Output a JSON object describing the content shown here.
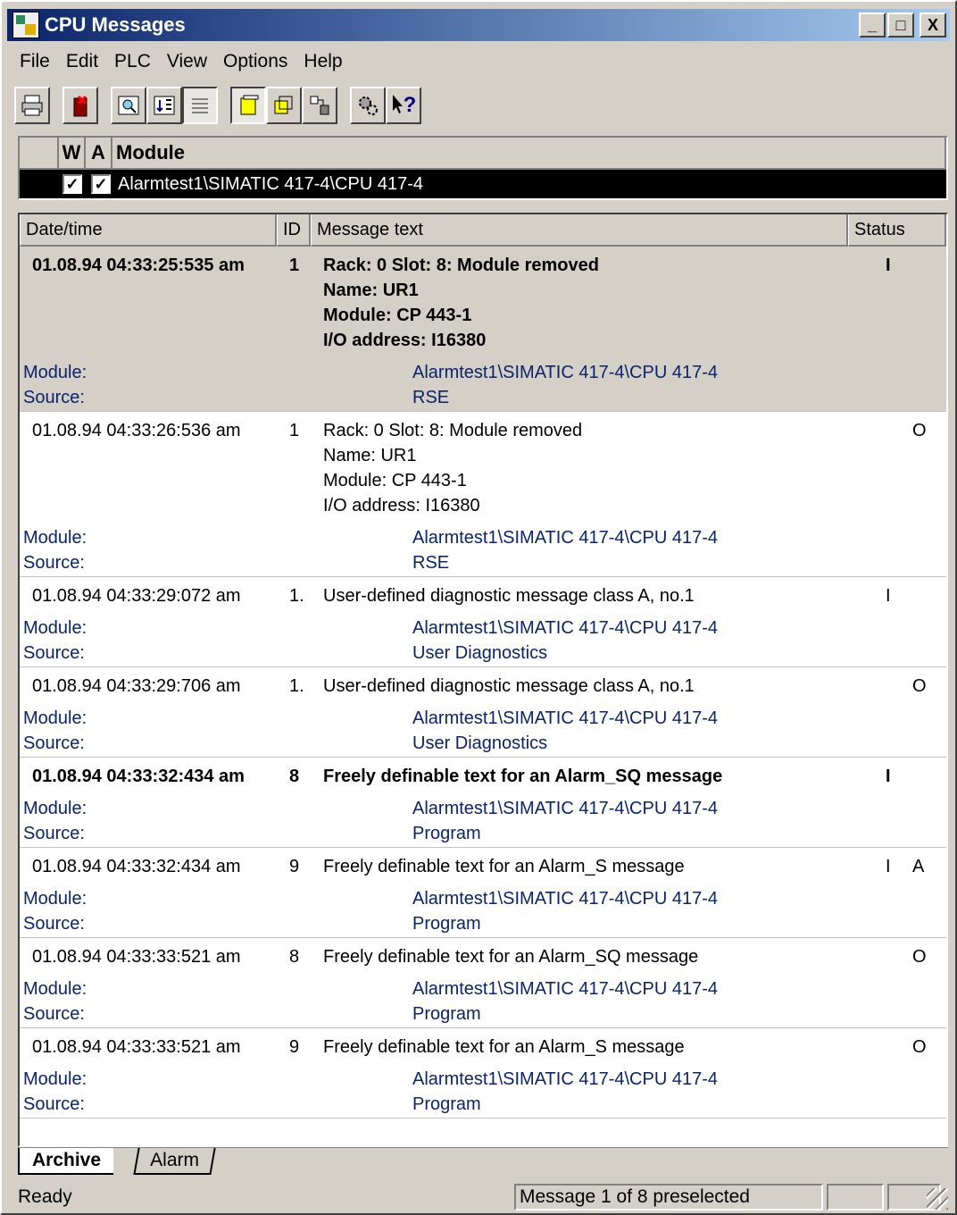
{
  "window": {
    "title": "CPU Messages"
  },
  "title_buttons": {
    "minimize": "_",
    "maximize": "□",
    "close": "X"
  },
  "menu": [
    {
      "label": "File"
    },
    {
      "label": "Edit"
    },
    {
      "label": "PLC"
    },
    {
      "label": "View"
    },
    {
      "label": "Options"
    },
    {
      "label": "Help"
    }
  ],
  "toolbar": {
    "icons": [
      "print-icon",
      "delete-icon",
      "view-icon",
      "sort-icon",
      "list-icon",
      "window-icon",
      "stack-icon",
      "diagnostic-icon",
      "settings-icon",
      "help-pointer-icon"
    ],
    "help_label": "?"
  },
  "module_table": {
    "headers": {
      "w": "W",
      "a": "A",
      "module": "Module"
    },
    "row": {
      "w_checked": "✓",
      "a_checked": "✓",
      "module": "Alarmtest1\\SIMATIC 417-4\\CPU 417-4"
    }
  },
  "message_list": {
    "headers": {
      "datetime": "Date/time",
      "id": "ID",
      "text": "Message text",
      "status": "Status"
    },
    "detail_labels": {
      "module": "Module:",
      "source": "Source:"
    },
    "messages": [
      {
        "datetime": "01.08.94  04:33:25:535 am",
        "id": "1",
        "text": "Rack: 0 Slot: 8: Module removed",
        "extra": [
          "Name: UR1",
          "Module: CP 443-1",
          "I/O address: I16380"
        ],
        "status1": "I",
        "status2": "",
        "module": "Alarmtest1\\SIMATIC 417-4\\CPU 417-4",
        "source": "RSE"
      },
      {
        "datetime": "01.08.94  04:33:26:536 am",
        "id": "1",
        "text": "Rack: 0 Slot: 8: Module removed",
        "extra": [
          "Name: UR1",
          "Module: CP 443-1",
          "I/O address: I16380"
        ],
        "status1": "",
        "status2": "O",
        "module": "Alarmtest1\\SIMATIC 417-4\\CPU 417-4",
        "source": "RSE"
      },
      {
        "datetime": "01.08.94  04:33:29:072 am",
        "id": "1.",
        "text": "User-defined diagnostic message class A, no.1",
        "extra": [],
        "status1": "I",
        "status2": "",
        "module": "Alarmtest1\\SIMATIC 417-4\\CPU 417-4",
        "source": "User Diagnostics"
      },
      {
        "datetime": "01.08.94  04:33:29:706 am",
        "id": "1.",
        "text": "User-defined diagnostic message class A, no.1",
        "extra": [],
        "status1": "",
        "status2": "O",
        "module": "Alarmtest1\\SIMATIC 417-4\\CPU 417-4",
        "source": "User Diagnostics"
      },
      {
        "datetime": "01.08.94  04:33:32:434 am",
        "id": "8",
        "text": "Freely definable text for an Alarm_SQ message",
        "extra": [],
        "status1": "I",
        "status2": "",
        "module": "Alarmtest1\\SIMATIC 417-4\\CPU 417-4",
        "source": "Program"
      },
      {
        "datetime": "01.08.94  04:33:32:434 am",
        "id": "9",
        "text": "Freely definable text for an Alarm_S message",
        "extra": [],
        "status1": "I",
        "status2": "A",
        "module": "Alarmtest1\\SIMATIC 417-4\\CPU 417-4",
        "source": "Program"
      },
      {
        "datetime": "01.08.94  04:33:33:521 am",
        "id": "8",
        "text": "Freely definable text for an Alarm_SQ message",
        "extra": [],
        "status1": "",
        "status2": "O",
        "module": "Alarmtest1\\SIMATIC 417-4\\CPU 417-4",
        "source": "Program"
      },
      {
        "datetime": "01.08.94  04:33:33:521 am",
        "id": "9",
        "text": "Freely definable text for an Alarm_S message",
        "extra": [],
        "status1": "",
        "status2": "O",
        "module": "Alarmtest1\\SIMATIC 417-4\\CPU 417-4",
        "source": "Program"
      }
    ]
  },
  "tabs": [
    {
      "label": "Archive"
    },
    {
      "label": "Alarm"
    }
  ],
  "statusbar": {
    "ready": "Ready",
    "message": "Message 1 of 8 preselected"
  }
}
